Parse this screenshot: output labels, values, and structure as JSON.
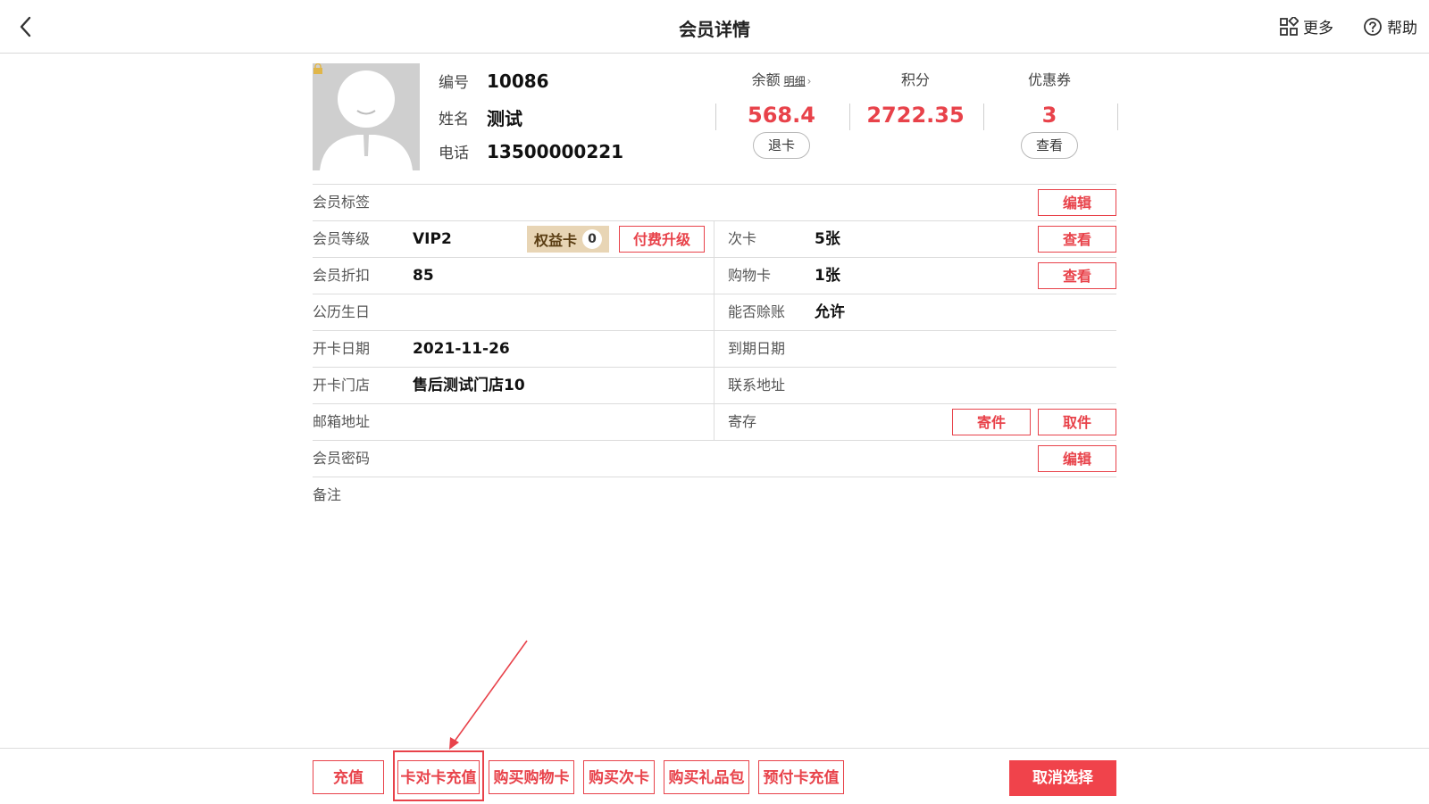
{
  "header": {
    "title": "会员详情",
    "more_label": "更多",
    "help_label": "帮助"
  },
  "member": {
    "id_label": "编号",
    "id_value": "10086",
    "name_label": "姓名",
    "name_value": "测试",
    "phone_label": "电话",
    "phone_value": "13500000221"
  },
  "stats": {
    "balance_label": "余额",
    "balance_detail": "明细",
    "balance_value": "568.4",
    "refund_label": "退卡",
    "points_label": "积分",
    "points_value": "2722.35",
    "coupon_label": "优惠券",
    "coupon_value": "3",
    "coupon_view_label": "查看"
  },
  "details": {
    "tag_label": "会员标签",
    "tag_edit": "编辑",
    "level_label": "会员等级",
    "level_value": "VIP2",
    "rights_label": "权益卡",
    "rights_count": "0",
    "upgrade_label": "付费升级",
    "times_card_label": "次卡",
    "times_card_value": "5张",
    "times_card_view": "查看",
    "discount_label": "会员折扣",
    "discount_value": "85",
    "shopping_card_label": "购物卡",
    "shopping_card_value": "1张",
    "shopping_card_view": "查看",
    "birthday_label": "公历生日",
    "credit_label": "能否赊账",
    "credit_value": "允许",
    "open_date_label": "开卡日期",
    "open_date_value": "2021-11-26",
    "expire_label": "到期日期",
    "open_store_label": "开卡门店",
    "open_store_value": "售后测试门店10",
    "address_label": "联系地址",
    "email_label": "邮箱地址",
    "storage_label": "寄存",
    "deposit_label": "寄件",
    "pickup_label": "取件",
    "password_label": "会员密码",
    "password_edit": "编辑",
    "remark_label": "备注"
  },
  "footer": {
    "recharge": "充值",
    "card_to_card": "卡对卡充值",
    "buy_shopping_card": "购买购物卡",
    "buy_times_card": "购买次卡",
    "buy_gift": "购买礼品包",
    "prepaid_recharge": "预付卡充值",
    "cancel_select": "取消选择"
  },
  "colors": {
    "accent": "#e8424a",
    "badge_bg": "#e8d5b5"
  }
}
